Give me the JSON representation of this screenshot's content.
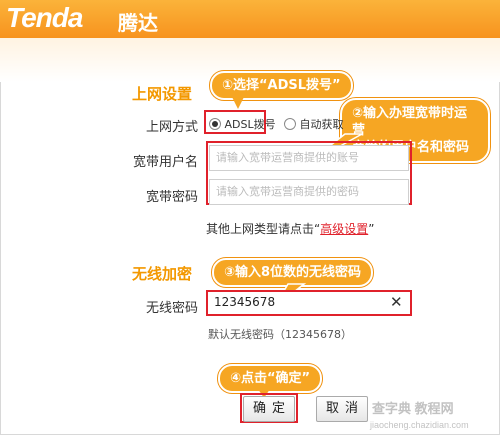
{
  "header": {
    "brand": "Tenda",
    "brand_cn": "腾达"
  },
  "wan": {
    "section_title": "上网设置",
    "mode_label": "上网方式",
    "mode_options": [
      {
        "label": "ADSL拨号",
        "selected": true
      },
      {
        "label": "自动获取",
        "selected": false
      }
    ],
    "username_label": "宽带用户名",
    "username_placeholder": "请输入宽带运营商提供的账号",
    "password_label": "宽带密码",
    "password_placeholder": "请输入宽带运营商提供的密码",
    "other_prefix": "其他上网类型请点击“",
    "other_link": "高级设置",
    "other_suffix": "”"
  },
  "wireless": {
    "section_title": "无线加密",
    "password_label": "无线密码",
    "password_value": "12345678",
    "default_hint": "默认无线密码（12345678）"
  },
  "buttons": {
    "ok": "确定",
    "cancel": "取消"
  },
  "callouts": {
    "c1": "①选择“ADSL拨号”",
    "c2_line1": "②输入办理宽带时运营",
    "c2_line2": "商给的用户名和密码",
    "c3": "③输入8位数的无线密码",
    "c4": "④点击“确定”"
  },
  "watermark": {
    "top": "查字典 教程网",
    "bottom": "jiaocheng.chazidian.com"
  },
  "colors": {
    "accent": "#f39800",
    "callout": "#f6a623",
    "highlight": "#e0212b"
  }
}
